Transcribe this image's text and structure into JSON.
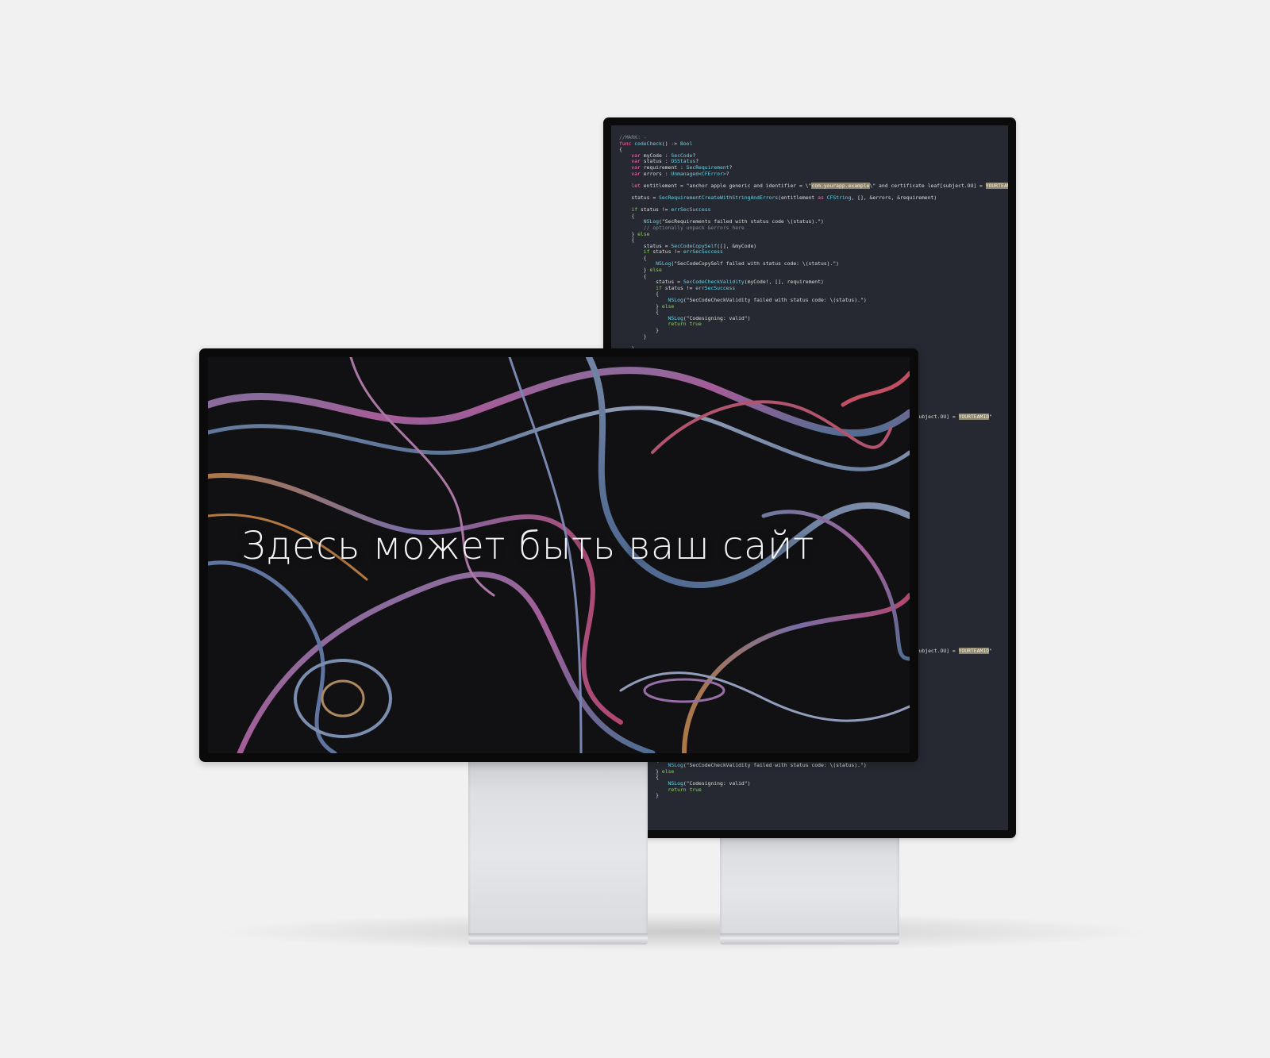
{
  "headline": "Здесь может быть ваш сайт",
  "code_lines": [
    [
      [
        "c-comment",
        "//MARK: -"
      ]
    ],
    [
      [
        "c-kw",
        "func "
      ],
      [
        "c-type",
        "codeCheck"
      ],
      [
        "c-plain",
        "() -> "
      ],
      [
        "c-type",
        "Bool"
      ]
    ],
    [
      [
        "c-plain",
        "{"
      ]
    ],
    [
      [
        "c-kw",
        "    var "
      ],
      [
        "c-plain",
        "myCode : "
      ],
      [
        "c-type",
        "SecCode"
      ],
      [
        "c-plain",
        "?"
      ]
    ],
    [
      [
        "c-kw",
        "    var "
      ],
      [
        "c-plain",
        "status : "
      ],
      [
        "c-type",
        "OSStatus"
      ],
      [
        "c-plain",
        "?"
      ]
    ],
    [
      [
        "c-kw",
        "    var "
      ],
      [
        "c-plain",
        "requirement : "
      ],
      [
        "c-type",
        "SecRequirement"
      ],
      [
        "c-plain",
        "?"
      ]
    ],
    [
      [
        "c-kw",
        "    var "
      ],
      [
        "c-plain",
        "errors : "
      ],
      [
        "c-type",
        "Unmanaged<CFError>"
      ],
      [
        "c-plain",
        "?"
      ]
    ],
    [
      [
        "c-plain",
        ""
      ]
    ],
    [
      [
        "c-kw",
        "    let "
      ],
      [
        "c-plain",
        "entitlement = \"anchor apple generic and identifier = \\\""
      ],
      [
        "c-hl",
        "com.yourapp.example"
      ],
      [
        "c-plain",
        "\\\" and certificate leaf[subject.OU] = "
      ],
      [
        "c-hl",
        "YOURTEAMID"
      ],
      [
        "c-plain",
        "\""
      ]
    ],
    [
      [
        "c-plain",
        ""
      ]
    ],
    [
      [
        "c-plain",
        "    status = "
      ],
      [
        "c-type",
        "SecRequirementCreateWithStringAndErrors"
      ],
      [
        "c-plain",
        "(entitlement "
      ],
      [
        "c-kw",
        "as "
      ],
      [
        "c-type",
        "CFString"
      ],
      [
        "c-plain",
        ", [], &errors, &requirement)"
      ]
    ],
    [
      [
        "c-plain",
        ""
      ]
    ],
    [
      [
        "c-kw2",
        "    if "
      ],
      [
        "c-plain",
        "status != "
      ],
      [
        "c-type",
        "errSecSuccess"
      ]
    ],
    [
      [
        "c-plain",
        "    {"
      ]
    ],
    [
      [
        "c-type",
        "        NSLog"
      ],
      [
        "c-plain",
        "(\"SecRequirements failed with status code \\(status).\")"
      ]
    ],
    [
      [
        "c-comment",
        "        // optionally unpack &errors here"
      ]
    ],
    [
      [
        "c-plain",
        "    } "
      ],
      [
        "c-kw2",
        "else"
      ]
    ],
    [
      [
        "c-plain",
        "    {"
      ]
    ],
    [
      [
        "c-plain",
        "        status = "
      ],
      [
        "c-type",
        "SecCodeCopySelf"
      ],
      [
        "c-plain",
        "([], &myCode)"
      ]
    ],
    [
      [
        "c-kw2",
        "        if "
      ],
      [
        "c-plain",
        "status != "
      ],
      [
        "c-type",
        "errSecSuccess"
      ]
    ],
    [
      [
        "c-plain",
        "        {"
      ]
    ],
    [
      [
        "c-type",
        "            NSLog"
      ],
      [
        "c-plain",
        "(\"SecCodeCopySelf failed with status code: \\(status).\")"
      ]
    ],
    [
      [
        "c-plain",
        "        } "
      ],
      [
        "c-kw2",
        "else"
      ]
    ],
    [
      [
        "c-plain",
        "        {"
      ]
    ],
    [
      [
        "c-plain",
        "            status = "
      ],
      [
        "c-type",
        "SecCodeCheckValidity"
      ],
      [
        "c-plain",
        "(myCode!, [], requirement)"
      ]
    ],
    [
      [
        "c-kw2",
        "            if "
      ],
      [
        "c-plain",
        "status != "
      ],
      [
        "c-type",
        "errSecSuccess"
      ]
    ],
    [
      [
        "c-plain",
        "            {"
      ]
    ],
    [
      [
        "c-type",
        "                NSLog"
      ],
      [
        "c-plain",
        "(\"SecCodeCheckValidity failed with status code: \\(status).\")"
      ]
    ],
    [
      [
        "c-plain",
        "            } "
      ],
      [
        "c-kw2",
        "else"
      ]
    ],
    [
      [
        "c-plain",
        "            {"
      ]
    ],
    [
      [
        "c-type",
        "                NSLog"
      ],
      [
        "c-plain",
        "(\"Codesigning: valid\")"
      ]
    ],
    [
      [
        "c-kw2",
        "                return true"
      ]
    ],
    [
      [
        "c-plain",
        "            }"
      ]
    ],
    [
      [
        "c-plain",
        "        }"
      ]
    ],
    [
      [
        "c-plain",
        ""
      ]
    ],
    [
      [
        "c-plain",
        "    }"
      ]
    ]
  ],
  "code_fragments": [
    [
      [
        "c-plain",
        "f[subject.OU] = "
      ],
      [
        "c-hl",
        "YOURTEAMID"
      ],
      [
        "c-plain",
        "\""
      ]
    ],
    [
      [
        "c-plain",
        "f[subject.OU] = "
      ],
      [
        "c-hl",
        "YOURTEAMID"
      ],
      [
        "c-plain",
        "\""
      ]
    ]
  ],
  "code_lines_bottom": [
    [
      [
        "c-kw2",
        "            if "
      ],
      [
        "c-plain",
        "status != "
      ],
      [
        "c-type",
        "errSecSuccess"
      ]
    ],
    [
      [
        "c-plain",
        "            {"
      ]
    ],
    [
      [
        "c-type",
        "                NSLog"
      ],
      [
        "c-plain",
        "(\"SecCodeCheckValidity failed with status code: \\(status).\")"
      ]
    ],
    [
      [
        "c-plain",
        "            } "
      ],
      [
        "c-kw2",
        "else"
      ]
    ],
    [
      [
        "c-plain",
        "            {"
      ]
    ],
    [
      [
        "c-type",
        "                NSLog"
      ],
      [
        "c-plain",
        "(\"Codesigning: valid\")"
      ]
    ],
    [
      [
        "c-kw2",
        "                return true"
      ]
    ],
    [
      [
        "c-plain",
        "            }"
      ]
    ]
  ]
}
